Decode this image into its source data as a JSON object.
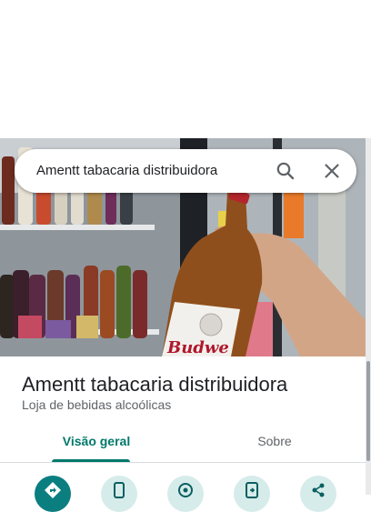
{
  "search": {
    "query": "Amentt tabacaria distribuidora",
    "search_icon": "search-icon",
    "close_icon": "close-icon"
  },
  "photo": {
    "description_icon": "place-photo",
    "beer_label": "Budwe"
  },
  "place": {
    "name": "Amentt tabacaria distribuidora",
    "category": "Loja de bebidas alcoólicas"
  },
  "tabs": [
    {
      "label": "Visão geral",
      "selected": true
    },
    {
      "label": "Sobre",
      "selected": false
    }
  ],
  "actions": [
    {
      "icon": "directions-icon"
    },
    {
      "icon": "phone-icon"
    },
    {
      "icon": "location-icon"
    },
    {
      "icon": "send-to-phone-icon"
    },
    {
      "icon": "share-icon"
    }
  ],
  "colors": {
    "accent": "#00796b",
    "primary_action": "#0b7e80",
    "secondary_action": "#d6ecea",
    "text_primary": "#202124",
    "text_secondary": "#5f6368"
  }
}
